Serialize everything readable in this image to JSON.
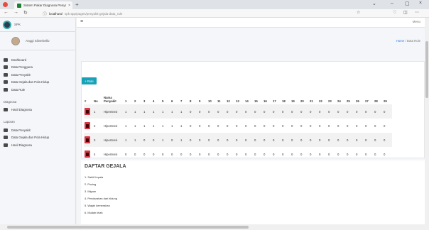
{
  "browser": {
    "tab_title": "Sistem Pakar Diagnosa Penyakit",
    "url_host": "localhost/",
    "url_path": "spk-app/pages/penyakit-gejala-data_rule"
  },
  "app": {
    "brand_name": "SPK",
    "user_name": "Anggi Silverbello"
  },
  "menu": {
    "items": [
      {
        "label": "Dashboard"
      },
      {
        "label": "Data Pengguna"
      },
      {
        "label": "Data Penyakit"
      },
      {
        "label": "Data Gejala dan Pola Hidup"
      },
      {
        "label": "Data Rule"
      }
    ],
    "section_diagnosa": "Diagnosa",
    "diagnosa_items": [
      {
        "label": "Hasil Diagnosa"
      }
    ],
    "section_laporan": "Laporan",
    "laporan_items": [
      {
        "label": "Data Penyakit"
      },
      {
        "label": "Data Gejala dan Pola Hidup"
      },
      {
        "label": "Hasil Diagnosa"
      }
    ]
  },
  "topbar": {
    "right_text": "Menu"
  },
  "breadcrumb": {
    "home": "Home",
    "sep": "/",
    "current": "Data Rule"
  },
  "buttons": {
    "add_label": "+ Rule"
  },
  "table": {
    "col_hash": "#",
    "col_no": "No",
    "col_name": "Nama Penyakit",
    "symptom_cols": [
      "1",
      "2",
      "3",
      "4",
      "5",
      "6",
      "7",
      "8",
      "9",
      "10",
      "11",
      "12",
      "13",
      "14",
      "15",
      "16",
      "17",
      "18",
      "19",
      "20",
      "21",
      "22",
      "23",
      "24",
      "25",
      "26",
      "27",
      "28",
      "29"
    ],
    "rows": [
      {
        "no": "1",
        "name": "Hipertensi",
        "vals": [
          "1",
          "1",
          "1",
          "1",
          "1",
          "1",
          "1",
          "0",
          "0",
          "0",
          "0",
          "0",
          "0",
          "0",
          "0",
          "0",
          "0",
          "0",
          "0",
          "0",
          "0",
          "0",
          "0",
          "0",
          "0",
          "0",
          "0",
          "0",
          "0"
        ]
      },
      {
        "no": "2",
        "name": "Hipertensi",
        "vals": [
          "1",
          "1",
          "1",
          "1",
          "1",
          "1",
          "1",
          "0",
          "0",
          "0",
          "0",
          "0",
          "0",
          "0",
          "0",
          "0",
          "0",
          "0",
          "0",
          "0",
          "0",
          "0",
          "0",
          "0",
          "0",
          "0",
          "0",
          "0",
          "0"
        ]
      },
      {
        "no": "3",
        "name": "Hipertensi",
        "vals": [
          "1",
          "1",
          "0",
          "0",
          "1",
          "0",
          "1",
          "0",
          "0",
          "0",
          "0",
          "0",
          "0",
          "0",
          "0",
          "0",
          "0",
          "0",
          "0",
          "0",
          "0",
          "0",
          "0",
          "0",
          "0",
          "0",
          "0",
          "0",
          "0"
        ]
      },
      {
        "no": "4",
        "name": "Hipertensi",
        "vals": [
          "0",
          "0",
          "0",
          "0",
          "0",
          "0",
          "0",
          "0",
          "0",
          "0",
          "0",
          "0",
          "0",
          "0",
          "0",
          "0",
          "0",
          "0",
          "0",
          "0",
          "0",
          "0",
          "0",
          "0",
          "0",
          "0",
          "0",
          "0",
          "0"
        ]
      }
    ]
  },
  "gejala": {
    "title": "DAFTAR GEJALA",
    "items": [
      {
        "label": "1. Sakit Kepala"
      },
      {
        "label": "2. Pusing"
      },
      {
        "label": "3. Migran"
      },
      {
        "label": "4. Pendarahan dari hidung"
      },
      {
        "label": "5. Wajah kemerahan"
      },
      {
        "label": "6. Mudah lelah"
      }
    ]
  }
}
